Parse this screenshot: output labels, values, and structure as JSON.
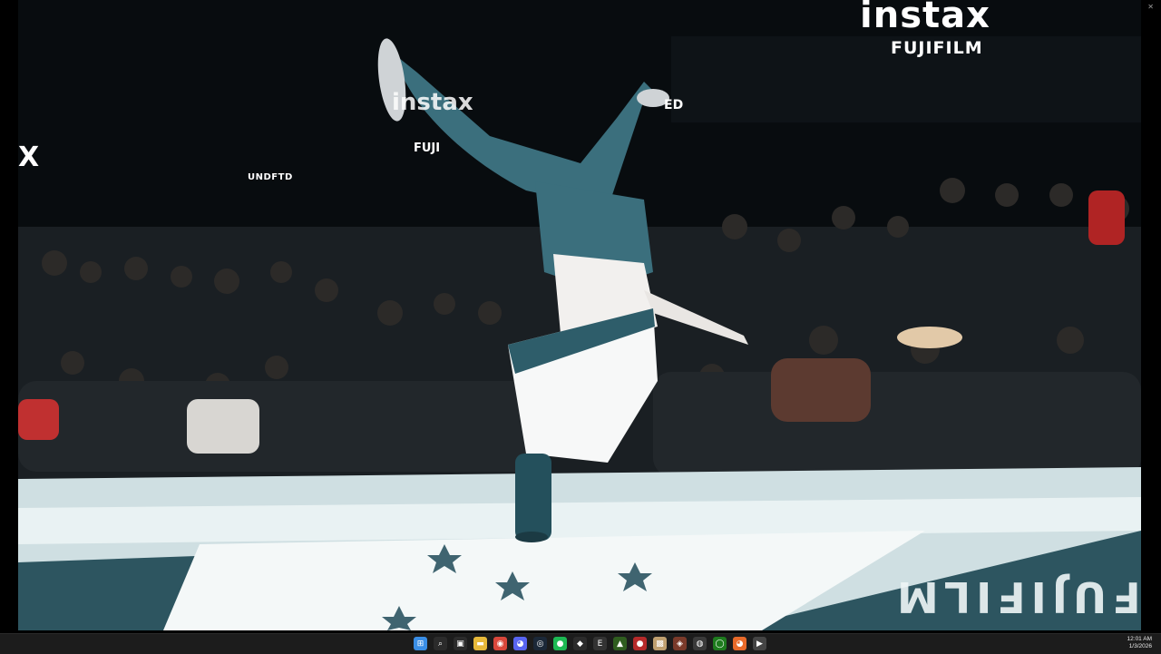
{
  "window": {
    "controls": {
      "minimize": "–",
      "maximize": "▫",
      "close": "✕"
    }
  },
  "video": {
    "signs": {
      "instax": "instax",
      "fujifilm": "FUJIFILM",
      "left_x": "X",
      "mid_instax": "instax",
      "mid_fuji": "FUJI",
      "undefeated": "UNDFTD",
      "ed": "ED"
    },
    "floor_text": "FUJIFILM"
  },
  "taskbar": {
    "icons": [
      {
        "name": "start-icon",
        "glyph": "⊞",
        "color": "#3a8ee6"
      },
      {
        "name": "search-icon",
        "glyph": "⌕",
        "color": "#2b2b2b"
      },
      {
        "name": "task-view-icon",
        "glyph": "▣",
        "color": "#2b2b2b"
      },
      {
        "name": "file-explorer-icon",
        "glyph": "▬",
        "color": "#e7b93a"
      },
      {
        "name": "chrome-icon",
        "glyph": "◉",
        "color": "#d9473b"
      },
      {
        "name": "discord-icon",
        "glyph": "◕",
        "color": "#5865f2"
      },
      {
        "name": "steam-icon",
        "glyph": "◎",
        "color": "#1b2838"
      },
      {
        "name": "spotify-icon",
        "glyph": "●",
        "color": "#1db954"
      },
      {
        "name": "app-icon",
        "glyph": "◆",
        "color": "#2b2b2b"
      },
      {
        "name": "epic-games-icon",
        "glyph": "E",
        "color": "#333333"
      },
      {
        "name": "nvidia-icon",
        "glyph": "▲",
        "color": "#2f5d1f"
      },
      {
        "name": "app-red-icon",
        "glyph": "●",
        "color": "#b52a2a"
      },
      {
        "name": "image-app-icon",
        "glyph": "▩",
        "color": "#c0a070"
      },
      {
        "name": "game-icon",
        "glyph": "◈",
        "color": "#7a3a2a"
      },
      {
        "name": "obs-icon",
        "glyph": "◍",
        "color": "#3a3a3a"
      },
      {
        "name": "xbox-icon",
        "glyph": "◯",
        "color": "#1e7b1e"
      },
      {
        "name": "firefox-icon",
        "glyph": "◕",
        "color": "#e86a2a"
      },
      {
        "name": "media-player-icon",
        "glyph": "▶",
        "color": "#444444"
      }
    ],
    "clock": {
      "time": "12:01 AM",
      "date": "1/3/2026"
    }
  }
}
